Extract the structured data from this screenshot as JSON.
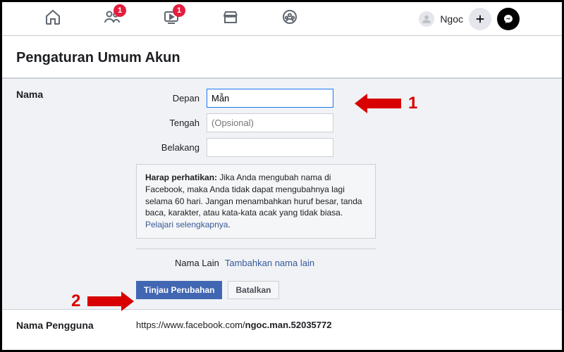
{
  "nav": {
    "badge_friends": "1",
    "badge_watch": "1",
    "user_name": "Ngoc"
  },
  "page_title": "Pengaturan Umum Akun",
  "name_section": {
    "label": "Nama",
    "first_lbl": "Depan",
    "first_val": "Mẫn",
    "middle_lbl": "Tengah",
    "middle_ph": "(Opsional)",
    "last_lbl": "Belakang",
    "last_val": "",
    "notice_strong": "Harap perhatikan:",
    "notice_text": " Jika Anda mengubah nama di Facebook, maka Anda tidak dapat mengubahnya lagi selama 60 hari. Jangan menambahkan huruf besar, tanda baca, karakter, atau kata-kata acak yang tidak biasa. ",
    "notice_link": "Pelajari selengkapnya",
    "other_name_lbl": "Nama Lain",
    "other_name_link": "Tambahkan nama lain",
    "btn_review": "Tinjau Perubahan",
    "btn_cancel": "Batalkan"
  },
  "username_section": {
    "label": "Nama Pengguna",
    "url_prefix": "https://www.facebook.com/",
    "url_bold": "ngoc.man.52035772"
  },
  "anno": {
    "one": "1",
    "two": "2"
  }
}
